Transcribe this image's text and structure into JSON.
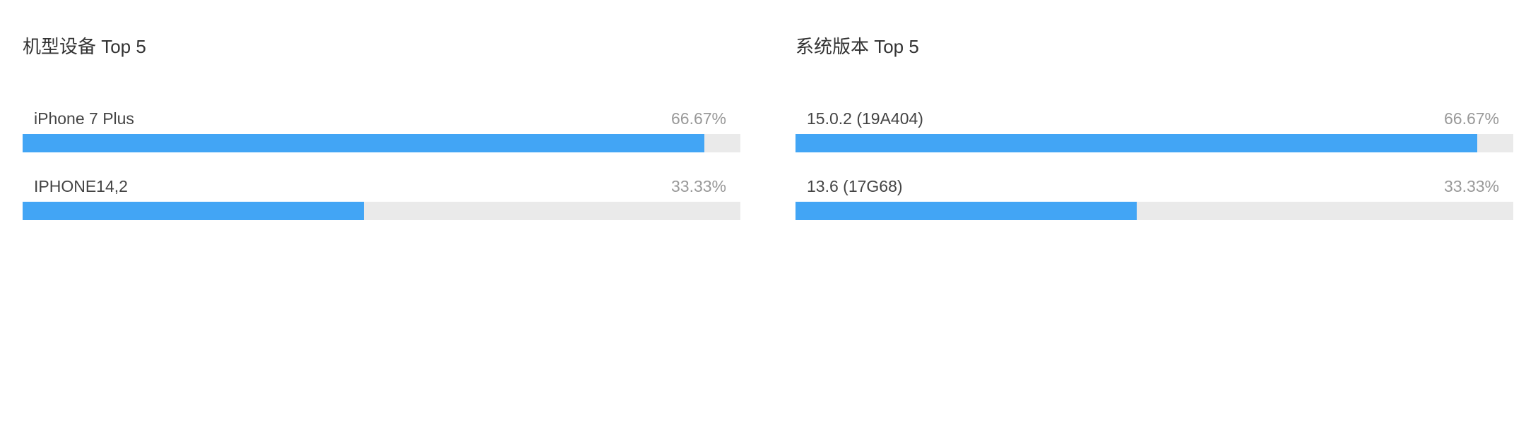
{
  "colors": {
    "bar_fill": "#42a5f5",
    "bar_track": "#eaeaea",
    "title_text": "#333333",
    "label_text": "#444444",
    "percent_text": "#999999"
  },
  "panels": [
    {
      "title": "机型设备 Top 5",
      "rows": [
        {
          "label": "iPhone 7 Plus",
          "percent_text": "66.67%",
          "fill": 0.95
        },
        {
          "label": "IPHONE14,2",
          "percent_text": "33.33%",
          "fill": 0.475
        }
      ]
    },
    {
      "title": "系统版本 Top 5",
      "rows": [
        {
          "label": "15.0.2 (19A404)",
          "percent_text": "66.67%",
          "fill": 0.95
        },
        {
          "label": "13.6 (17G68)",
          "percent_text": "33.33%",
          "fill": 0.475
        }
      ]
    }
  ]
}
